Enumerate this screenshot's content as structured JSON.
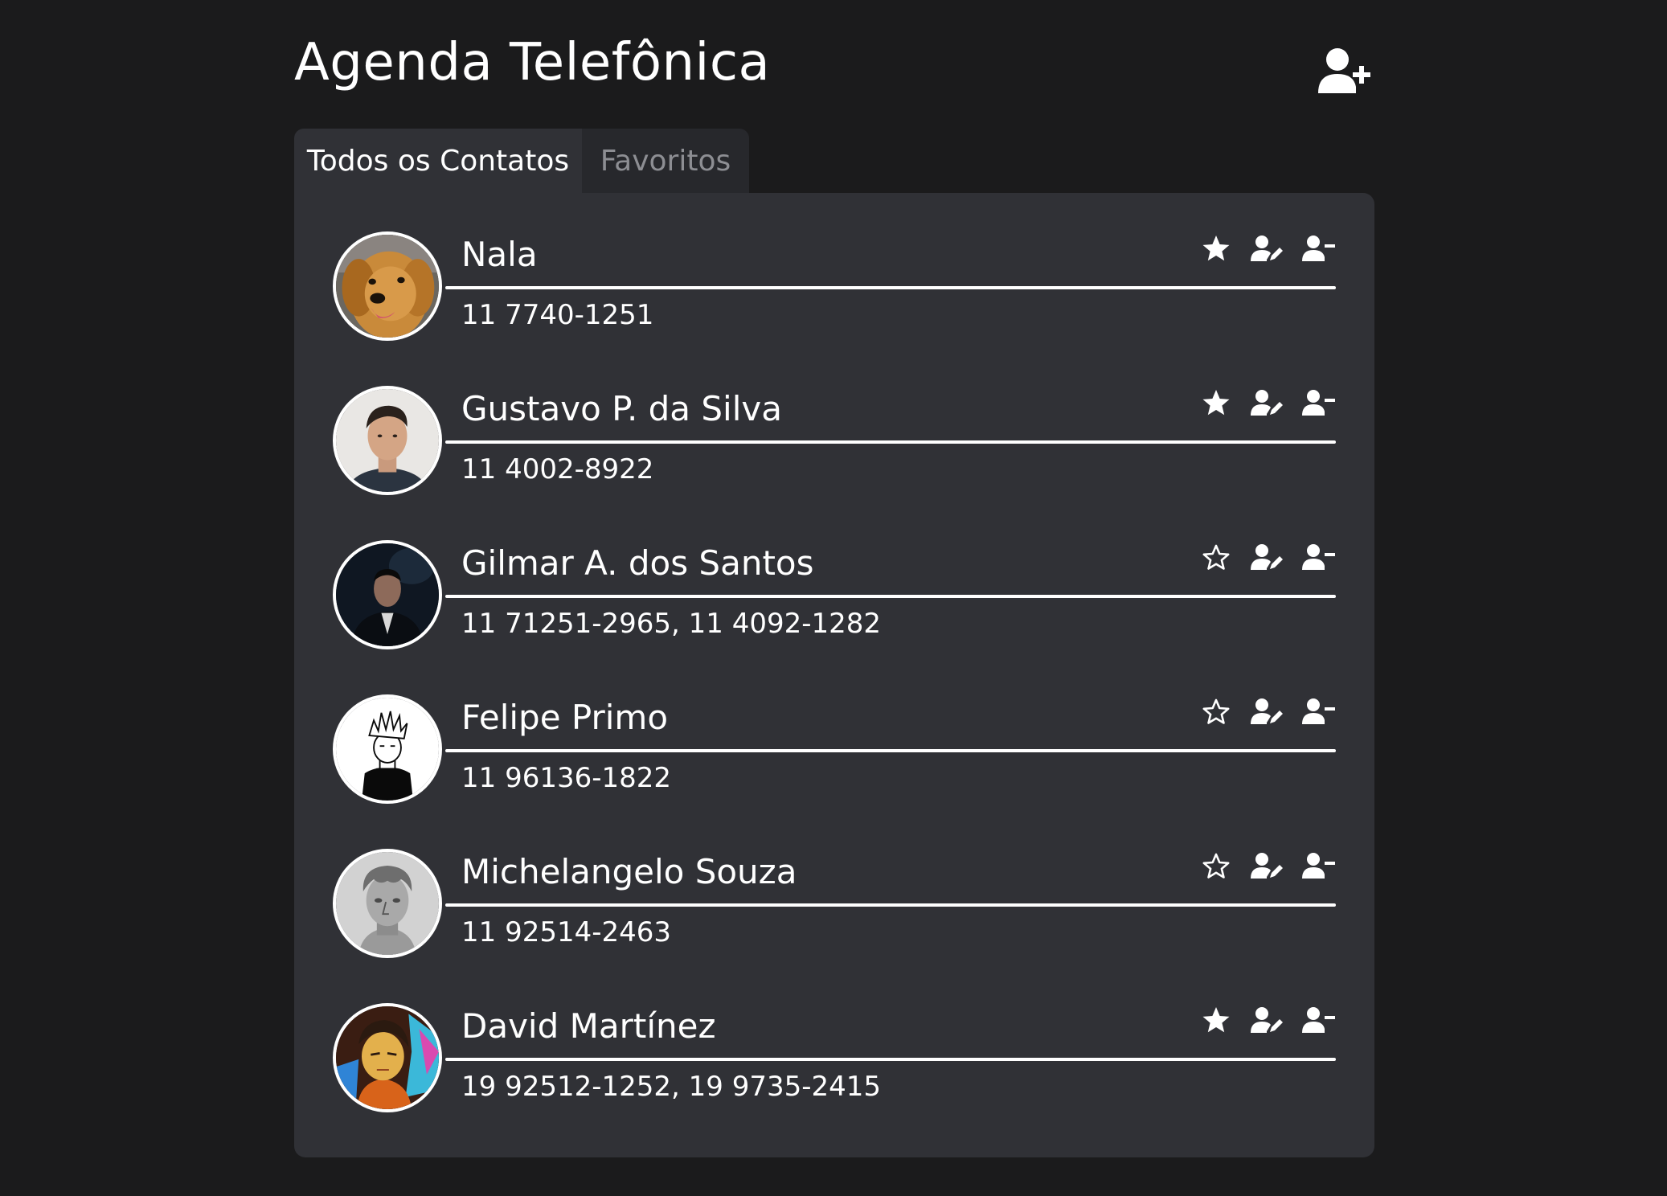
{
  "header": {
    "title": "Agenda Telefônica",
    "add_contact_icon": "user-plus-icon"
  },
  "tabs": [
    {
      "label": "Todos os Contatos",
      "active": true
    },
    {
      "label": "Favoritos",
      "active": false
    }
  ],
  "colors": {
    "background": "#1b1b1c",
    "panel": "#303136",
    "inactive_tab": "#27282c",
    "text": "#ffffff",
    "muted_text": "#8d8e93"
  },
  "contacts": [
    {
      "name": "Nala",
      "phones": "11 7740-1251",
      "favorite": true,
      "avatar": "golden-retriever-photo"
    },
    {
      "name": "Gustavo P. da Silva",
      "phones": "11 4002-8922",
      "favorite": true,
      "avatar": "man-portrait-photo"
    },
    {
      "name": "Gilmar A. dos Santos",
      "phones": "11 71251-2965, 11 4092-1282",
      "favorite": false,
      "avatar": "dark-suit-portrait-photo"
    },
    {
      "name": "Felipe Primo",
      "phones": "11 96136-1822",
      "favorite": false,
      "avatar": "spiky-hair-drawing"
    },
    {
      "name": "Michelangelo Souza",
      "phones": "11 92514-2463",
      "favorite": false,
      "avatar": "statue-of-david-photo"
    },
    {
      "name": "David Martínez",
      "phones": "19 92512-1252, 19 9735-2415",
      "favorite": true,
      "avatar": "anime-character-drawing"
    }
  ],
  "actions": {
    "favorite_icon": "star-icon",
    "edit_icon": "user-edit-icon",
    "remove_icon": "user-minus-icon"
  }
}
